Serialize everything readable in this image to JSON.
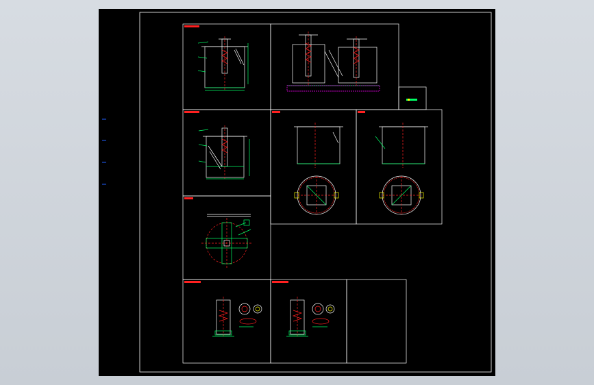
{
  "drawing": {
    "background": "#000000",
    "frame_color": "#ffffff",
    "accent_red": "#ff2020",
    "accent_green": "#00ff66",
    "accent_magenta": "#ff00ff",
    "accent_cyan": "#00ffff",
    "accent_yellow": "#ffff00",
    "accent_blue": "#2060ff"
  }
}
